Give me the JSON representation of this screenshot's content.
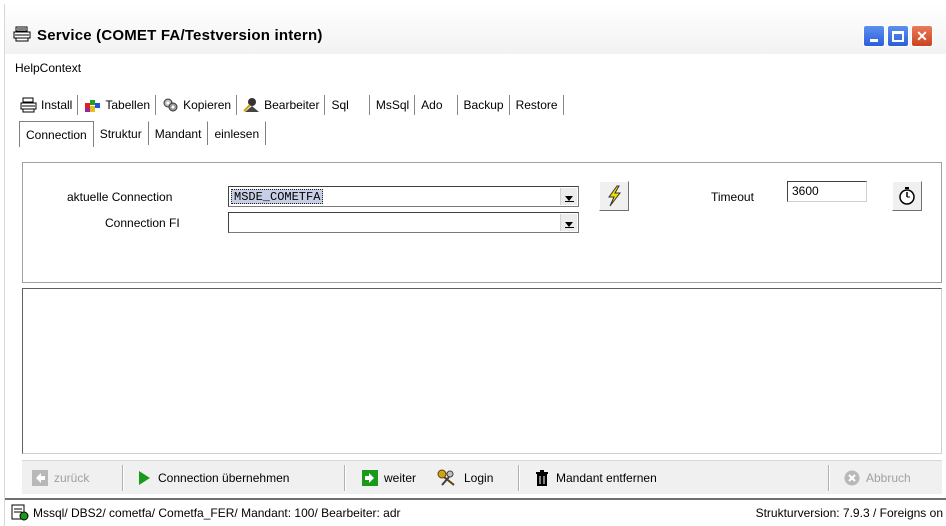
{
  "window": {
    "title": "Service (COMET FA/Testversion intern)",
    "title_icon": "printer-icon"
  },
  "menu": {
    "items": [
      "HelpContext"
    ]
  },
  "main_tabs": [
    {
      "label": "Install",
      "icon": "install-icon"
    },
    {
      "label": "Tabellen",
      "icon": "tables-icon"
    },
    {
      "label": "Kopieren",
      "icon": "copy-icon"
    },
    {
      "label": "Bearbeiter",
      "icon": "user-edit-icon"
    },
    {
      "label": "Sql"
    },
    {
      "label": "MsSql"
    },
    {
      "label": "Ado"
    },
    {
      "label": "Backup"
    },
    {
      "label": "Restore"
    }
  ],
  "sub_tabs": [
    {
      "label": "Connection",
      "active": true
    },
    {
      "label": "Struktur"
    },
    {
      "label": "Mandant"
    },
    {
      "label": "einlesen"
    }
  ],
  "connection": {
    "current_label": "aktuelle Connection",
    "current_value": "MSDE_COMETFA",
    "fi_label": "Connection FI",
    "fi_value": "",
    "timeout_label": "Timeout",
    "timeout_value": "3600"
  },
  "buttons": {
    "back": "zurück",
    "apply": "Connection übernehmen",
    "next": "weiter",
    "login": "Login",
    "remove_mandant": "Mandant entfernen",
    "cancel": "Abbruch"
  },
  "status": {
    "left": "Mssql/ DBS2/ cometfa/ Cometfa_FER/ Mandant: 100/ Bearbeiter: adr",
    "right": "Strukturversion: 7.9.3 / Foreigns on"
  },
  "colors": {
    "title_min_max": "#2b5fd9",
    "title_close": "#c9431f",
    "selection": "#c7cfe6",
    "apply_green": "#1a9a1a",
    "lightning": "#e8e000"
  }
}
